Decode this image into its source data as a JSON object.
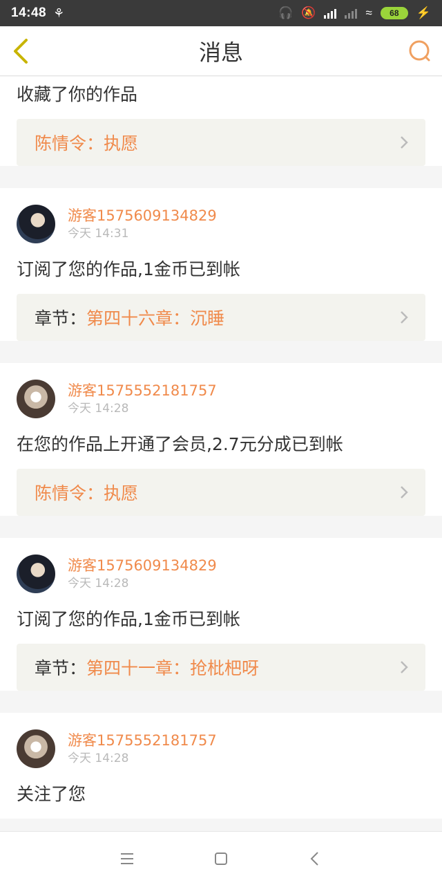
{
  "status_bar": {
    "time": "14:48",
    "battery": "68",
    "icons": [
      "ghost-icon",
      "headphones-icon",
      "mute-bell-icon",
      "hd-signal-icon",
      "signal-icon",
      "wifi-icon",
      "battery-icon",
      "charging-icon"
    ]
  },
  "header": {
    "title": "消息",
    "back_icon": "chevron-left-icon",
    "search_icon": "search-icon",
    "accent": "#f08a4b",
    "back_color": "#c8b400"
  },
  "messages": [
    {
      "action": "收藏了你的作品",
      "work_prefix": "",
      "work_title": "陈情令：执愿"
    },
    {
      "user": "游客1575609134829",
      "time": "今天 14:31",
      "action": "订阅了您的作品,1金币已到帐",
      "work_prefix": "章节：",
      "work_title": "第四十六章：沉睡"
    },
    {
      "user": "游客1575552181757",
      "time": "今天 14:28",
      "action": "在您的作品上开通了会员,2.7元分成已到帐",
      "work_prefix": "",
      "work_title": "陈情令：执愿"
    },
    {
      "user": "游客1575609134829",
      "time": "今天 14:28",
      "action": "订阅了您的作品,1金币已到帐",
      "work_prefix": "章节：",
      "work_title": "第四十一章：抢枇杷呀"
    },
    {
      "user": "游客1575552181757",
      "time": "今天 14:28",
      "action": "关注了您"
    }
  ],
  "nav_bar": {
    "icons": [
      "menu-icon",
      "home-icon",
      "back-icon"
    ]
  }
}
